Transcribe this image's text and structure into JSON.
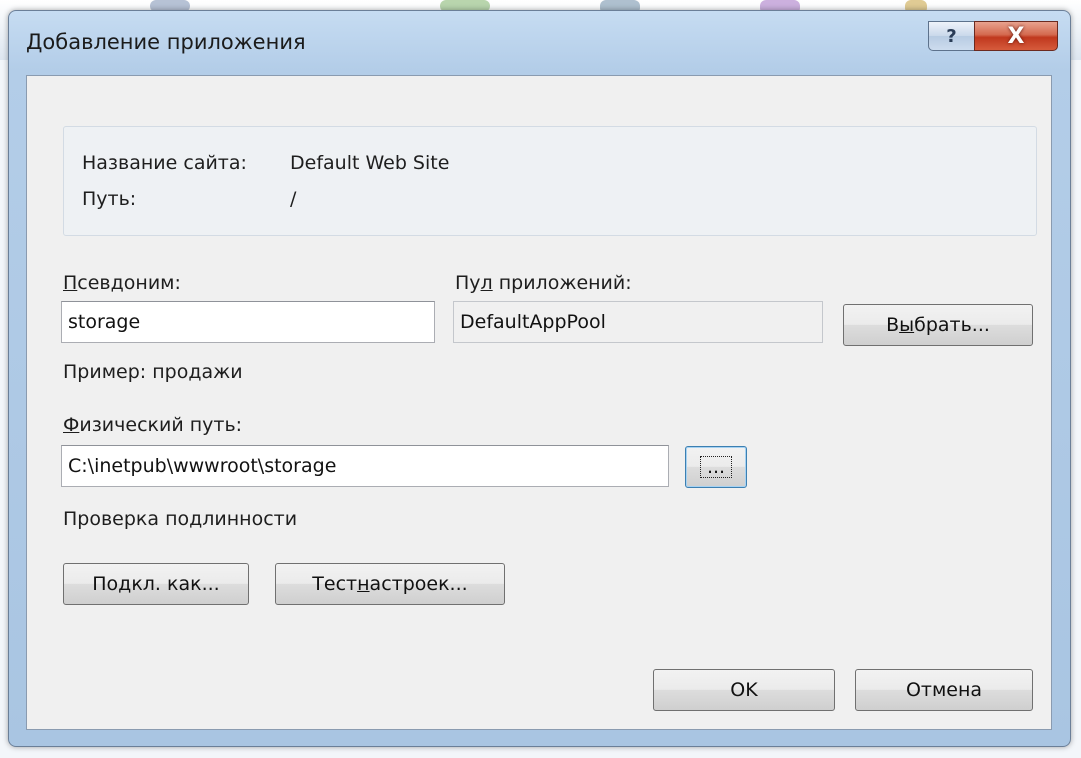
{
  "window": {
    "title": "Добавление приложения",
    "help_glyph": "?",
    "close_glyph": "X"
  },
  "info": {
    "site_name_label": "Название сайта:",
    "site_name_value": "Default Web Site",
    "path_label": "Путь:",
    "path_value": "/"
  },
  "alias": {
    "label_hotkey": "П",
    "label_rest": "севдоним:",
    "value": "storage",
    "example": "Пример: продажи"
  },
  "app_pool": {
    "label_pre": "Пу",
    "label_hotkey": "л",
    "label_post": " приложений:",
    "value": "DefaultAppPool",
    "select_pre": "В",
    "select_hotkey": "ы",
    "select_post": "брать..."
  },
  "physical_path": {
    "label_hotkey": "Ф",
    "label_rest": "изический путь:",
    "value": "C:\\inetpub\\wwwroot\\storage",
    "browse_label": "..."
  },
  "auth": {
    "heading": "Проверка подлинности",
    "connect_pre": "По",
    "connect_hotkey": "д",
    "connect_post": "кл. как...",
    "test_pre": "Тест ",
    "test_hotkey": "н",
    "test_post": "астроек..."
  },
  "footer": {
    "ok_label": "OK",
    "cancel_label": "Отмена"
  },
  "colors": {
    "frame": "#b3cde8",
    "close_button": "#c0381e",
    "client_bg": "#f0f0f0"
  }
}
